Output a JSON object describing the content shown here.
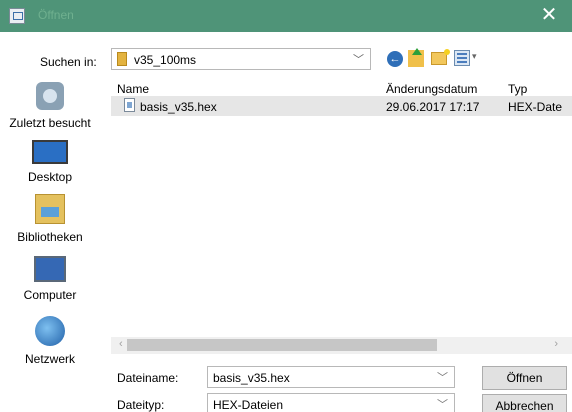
{
  "window": {
    "title": "Öffnen",
    "close_glyph": "✕"
  },
  "lookin": {
    "label": "Suchen in:",
    "value": "v35_100ms"
  },
  "places": [
    {
      "label": "Zuletzt besucht",
      "icon": "recent-places-icon"
    },
    {
      "label": "Desktop",
      "icon": "desktop-icon"
    },
    {
      "label": "Bibliotheken",
      "icon": "libraries-icon"
    },
    {
      "label": "Computer",
      "icon": "computer-icon"
    },
    {
      "label": "Netzwerk",
      "icon": "network-icon"
    }
  ],
  "columns": {
    "name": "Name",
    "date": "Änderungsdatum",
    "type": "Typ"
  },
  "files": [
    {
      "name": "basis_v35.hex",
      "date": "29.06.2017 17:17",
      "type": "HEX-Date"
    }
  ],
  "filename": {
    "label": "Dateiname:",
    "value": "basis_v35.hex"
  },
  "filetype": {
    "label": "Dateityp:",
    "value": "HEX-Dateien"
  },
  "buttons": {
    "open": "Öffnen",
    "cancel": "Abbrechen"
  },
  "colors": {
    "titlebar": "#4f9478",
    "selection": "#e6e6e6"
  }
}
